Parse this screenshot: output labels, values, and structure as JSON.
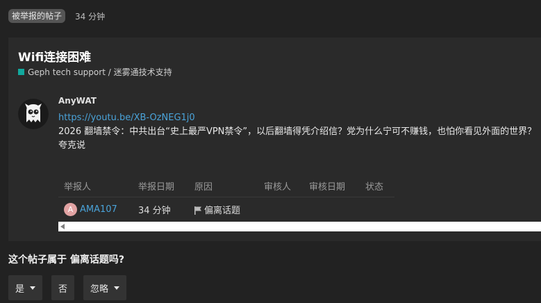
{
  "header": {
    "flagged_badge": "被举报的帖子",
    "age": "34 分钟"
  },
  "topic": {
    "title": "Wifi连接困难",
    "category": "Geph tech support / 迷雾通技术支持",
    "category_color": "#12a89d"
  },
  "post": {
    "username": "AnyWAT",
    "link": "https://youtu.be/XB-OzNEG1j0",
    "text": "2026 翻墙禁令：中共出台“史上最严VPN禁令”，以后翻墙得凭介绍信？党为什么宁可不赚钱，也怕你看见外面的世界？夸克说"
  },
  "reports_table": {
    "headers": [
      "举报人",
      "举报日期",
      "原因",
      "审核人",
      "审核日期",
      "状态"
    ],
    "rows": [
      {
        "avatar_letter": "A",
        "reporter": "AMA107",
        "date": "34 分钟",
        "reason": "偏离话题",
        "reviewer": "",
        "review_date": "",
        "status": ""
      }
    ]
  },
  "question": "这个帖子属于 偏离话题吗?",
  "actions": {
    "yes": "是",
    "no": "否",
    "ignore": "忽略"
  },
  "icons": {
    "avatar": "ghost-mascot-icon",
    "flag": "flag-icon",
    "dropdown": "caret-down-icon",
    "scroll_left": "scroll-left-arrow-icon"
  }
}
